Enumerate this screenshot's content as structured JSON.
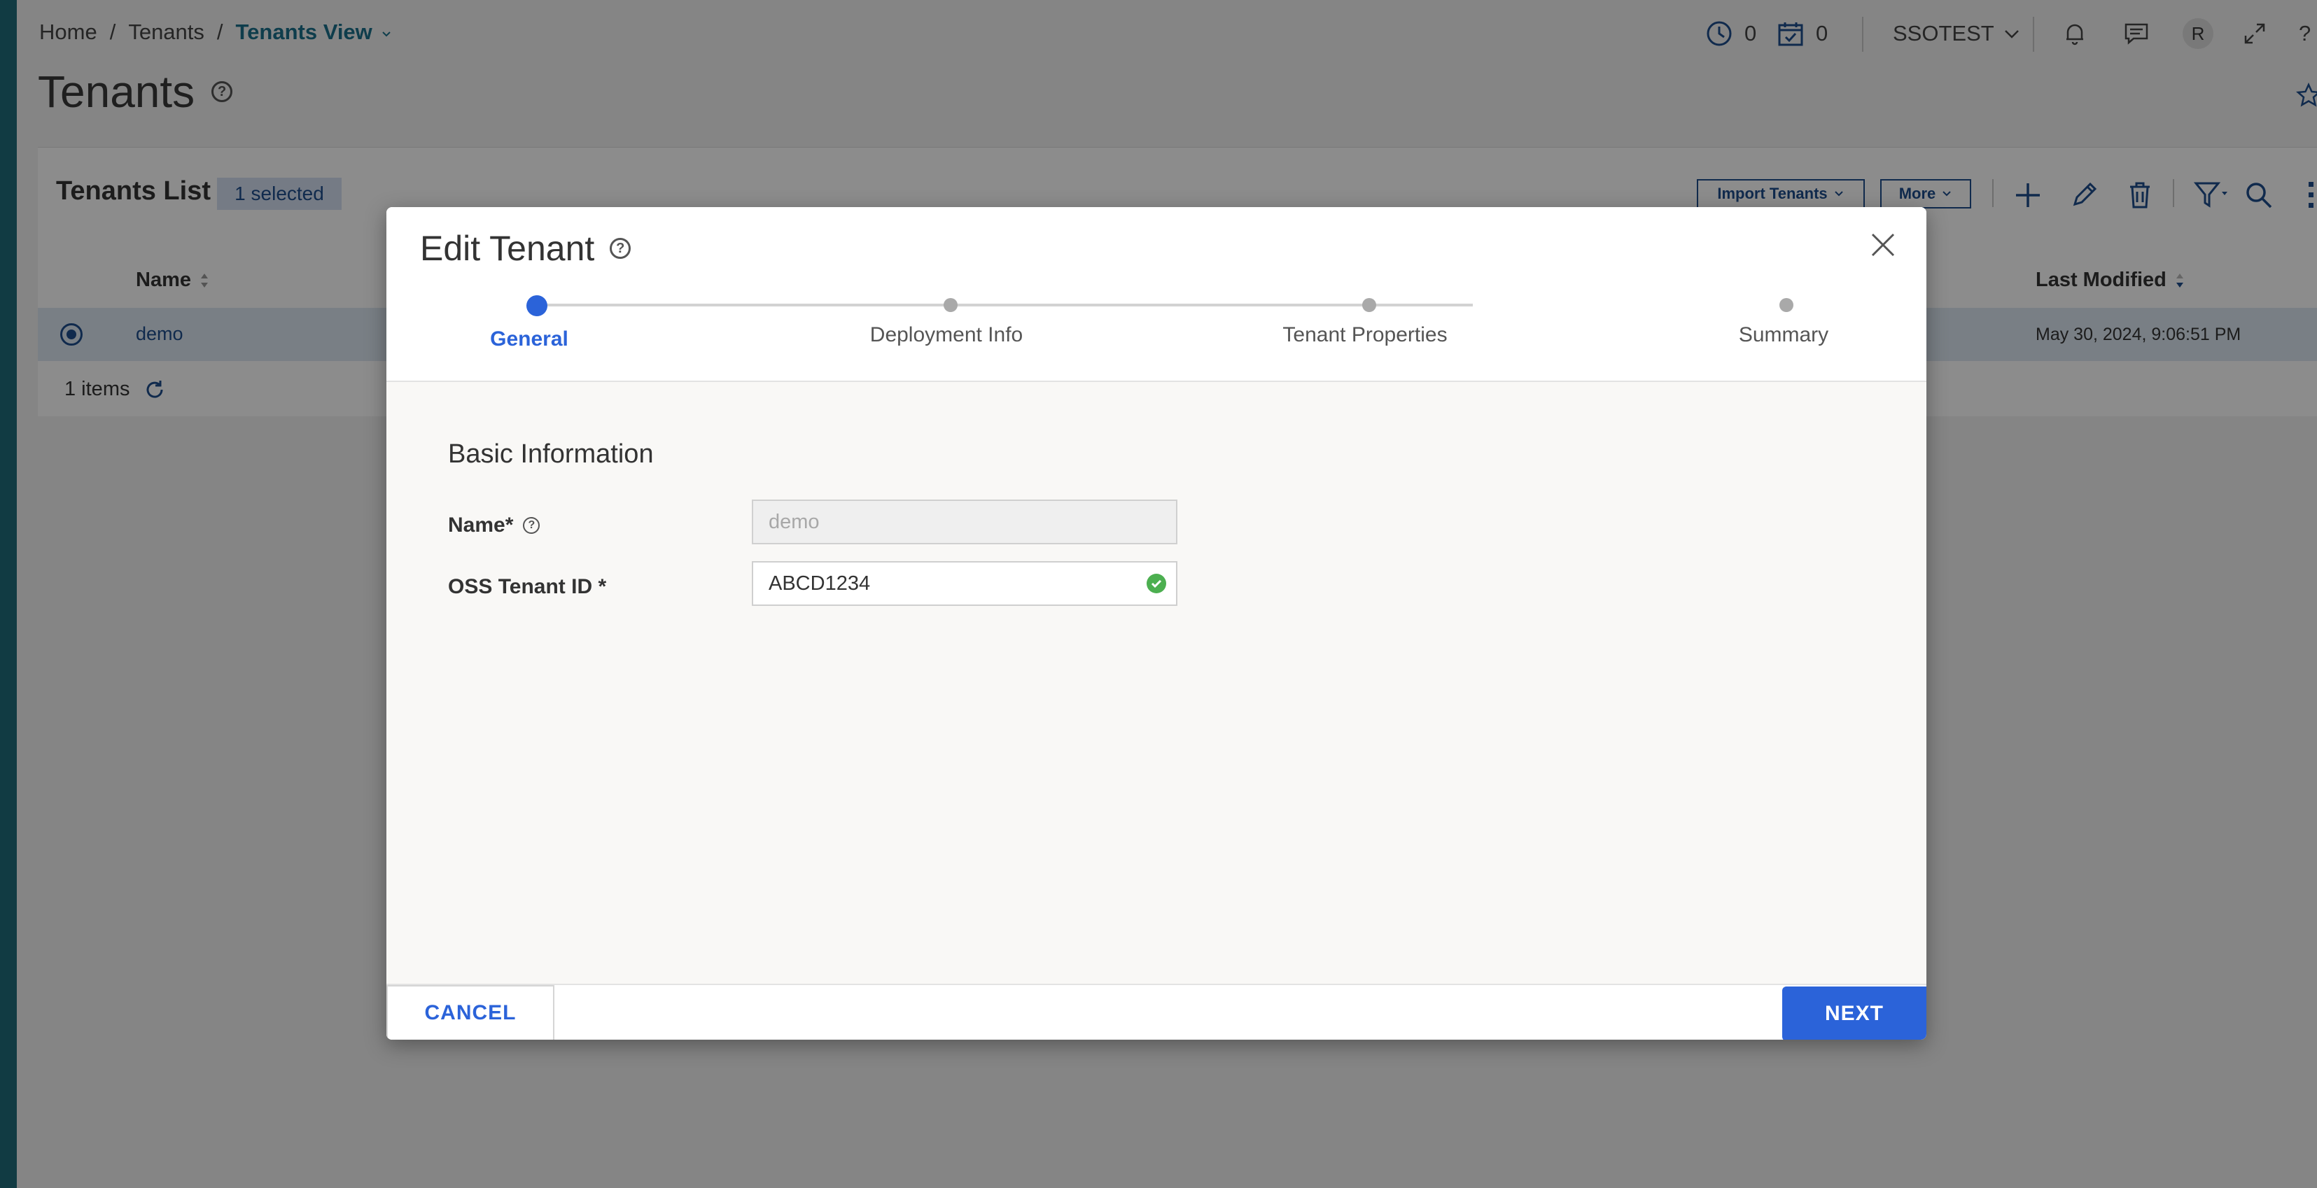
{
  "breadcrumb": {
    "home": "Home",
    "sep1": "/",
    "tenants": "Tenants",
    "sep2": "/",
    "current": "Tenants View"
  },
  "topbar": {
    "clock_count": "0",
    "calendar_count": "0",
    "user_menu": "SSOTEST",
    "avatar_initial": "R",
    "help": "?"
  },
  "page": {
    "title": "Tenants"
  },
  "list": {
    "title": "Tenants List",
    "selected_badge": "1 selected",
    "import_button": "Import Tenants",
    "more_button": "More",
    "columns": {
      "name": "Name",
      "last_modified": "Last Modified"
    },
    "rows": [
      {
        "name": "demo",
        "last_modified": "May 30, 2024, 9:06:51 PM"
      }
    ],
    "item_count": "1 items"
  },
  "modal": {
    "title": "Edit Tenant",
    "steps": [
      "General",
      "Deployment Info",
      "Tenant Properties",
      "Summary"
    ],
    "active_step": "General",
    "section_title": "Basic Information",
    "fields": [
      {
        "label": "Name*",
        "value": "demo",
        "disabled": true
      },
      {
        "label": "OSS Tenant ID *",
        "value": "ABCD1234",
        "valid": true
      }
    ],
    "cancel_label": "CANCEL",
    "next_label": "NEXT"
  },
  "colors": {
    "accent": "#2b63d9",
    "navy": "#1e4e8c",
    "teal": "#1b6f8a",
    "valid": "#4caf50"
  }
}
